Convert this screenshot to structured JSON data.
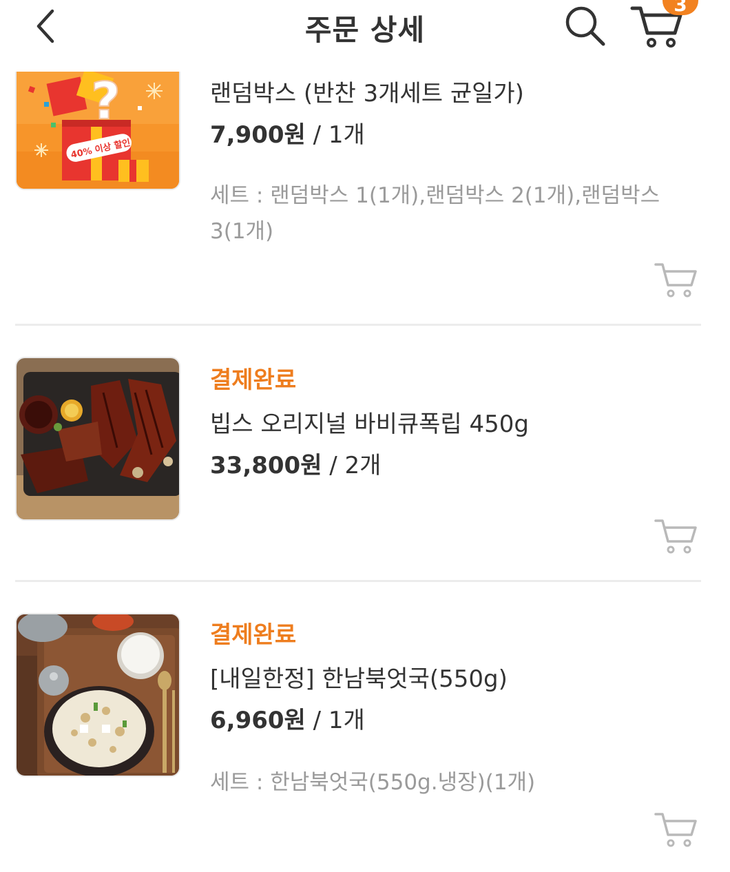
{
  "header": {
    "title": "주문 상세",
    "cart_count": "3"
  },
  "items": [
    {
      "name": "랜덤박스 (반찬 3개세트 균일가)",
      "price": "7,900원",
      "quantity": " / 1개",
      "set_info": "세트 : 랜덤박스 1(1개),랜덤박스 2(1개),랜덤박스 3(1개)",
      "image_badge": "40% 이상 할인"
    },
    {
      "status": "결제완료",
      "name": "빕스 오리지널 바비큐폭립 450g",
      "price": "33,800원",
      "quantity": " / 2개"
    },
    {
      "status": "결제완료",
      "name": "[내일한정] 한남북엇국(550g)",
      "price": "6,960원",
      "quantity": " / 1개",
      "set_info": "세트 : 한남북엇국(550g.냉장)(1개)"
    }
  ],
  "colors": {
    "accent": "#ee7d1e",
    "badge": "#f28220",
    "text": "#333333",
    "muted": "#9a9a9a",
    "divider": "#ececec"
  },
  "icons": [
    "back-arrow-icon",
    "search-icon",
    "cart-icon",
    "add-to-cart-icon"
  ]
}
